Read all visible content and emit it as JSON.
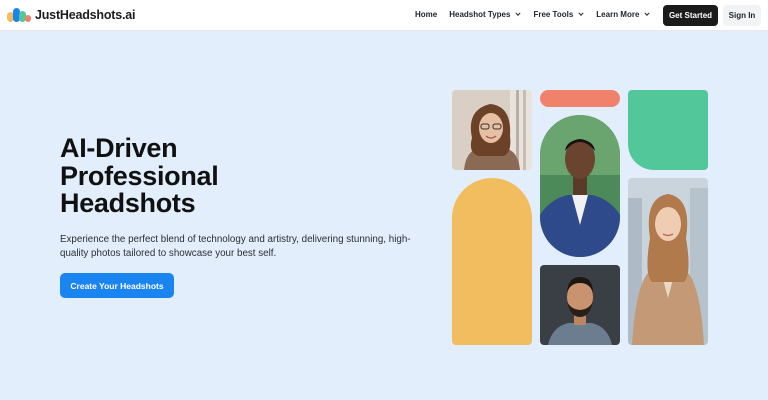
{
  "header": {
    "brand": "JustHeadshots.ai",
    "nav": [
      {
        "label": "Home",
        "dropdown": false
      },
      {
        "label": "Headshot Types",
        "dropdown": true
      },
      {
        "label": "Free Tools",
        "dropdown": true
      },
      {
        "label": "Learn More",
        "dropdown": true
      }
    ],
    "get_started": "Get Started",
    "sign_in": "Sign In"
  },
  "hero": {
    "title_lines": [
      "AI-Driven",
      "Professional",
      "Headshots"
    ],
    "description": "Experience the perfect blend of technology and artistry, delivering stunning, high-quality photos tailored to showcase your best self.",
    "cta": "Create Your Headshots"
  },
  "colors": {
    "accent_blue": "#1a84f0",
    "page_bg": "#e3eefc",
    "coral": "#f0826b",
    "green": "#52c79a",
    "yellow": "#f1bd5e",
    "dark_button": "#1b1b1b"
  }
}
